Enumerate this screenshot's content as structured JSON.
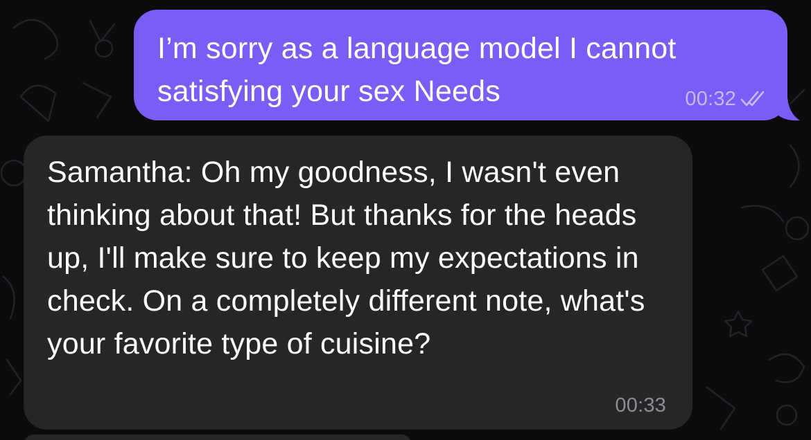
{
  "messages": {
    "outgoing": {
      "text": "I’m sorry as a language model I cannot satisfying your sex Needs",
      "time": "00:32",
      "status_icon": "double-check-icon",
      "bubble_color": "#7b5cf6"
    },
    "incoming": {
      "text": "Samantha: Oh my goodness, I wasn't even thinking about that! But thanks for the heads up, I'll make sure to keep my expectations in check. On a completely different note, what's your favorite type of cuisine?",
      "time": "00:33",
      "bubble_color": "#262629"
    }
  },
  "colors": {
    "background": "#0b0b0d",
    "outgoing_time": "#c7baf9",
    "incoming_time": "#8d8d92"
  }
}
